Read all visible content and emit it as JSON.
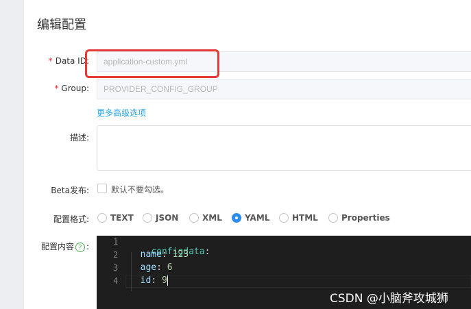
{
  "page": {
    "title": "编辑配置"
  },
  "form": {
    "data_id": {
      "label": "Data ID:",
      "required_mark": "*",
      "value": "application-custom.yml"
    },
    "group": {
      "label": "Group:",
      "required_mark": "*",
      "value": "PROVIDER_CONFIG_GROUP"
    },
    "advanced_link": "更多高级选项",
    "description": {
      "label": "描述:",
      "value": ""
    },
    "beta": {
      "label": "Beta发布:",
      "checkbox_label": "默认不要勾选。",
      "checked": false
    },
    "format": {
      "label": "配置格式:",
      "options": [
        "TEXT",
        "JSON",
        "XML",
        "YAML",
        "HTML",
        "Properties"
      ],
      "selected": "YAML"
    },
    "content": {
      "label": "配置内容",
      "help_icon": "?",
      "label_suffix": ":"
    }
  },
  "editor": {
    "line_numbers": [
      "1",
      "2",
      "3",
      "4"
    ],
    "lines": [
      {
        "key": "configdata",
        "sep": ":",
        "value": ""
      },
      {
        "key": "name",
        "sep": ": ",
        "value": "123"
      },
      {
        "key": "age",
        "sep": ": ",
        "value": "6"
      },
      {
        "key": "id",
        "sep": ": ",
        "value": "9"
      }
    ]
  },
  "watermark": "CSDN @小脑斧攻城狮",
  "colors": {
    "accent": "#2d8cf0",
    "link": "#1ea1e6",
    "required": "#f5222d",
    "highlight": "#e53935"
  }
}
